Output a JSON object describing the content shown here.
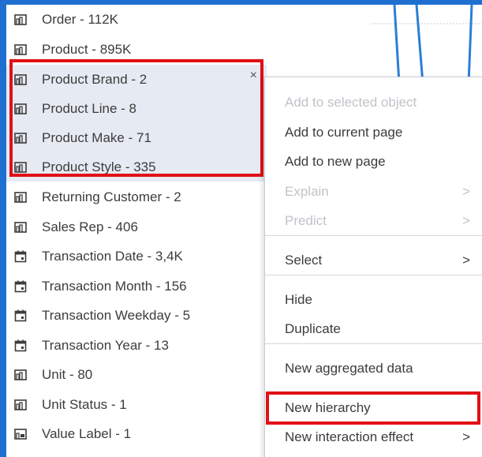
{
  "data_items": [
    {
      "label": "Order - 112K",
      "icon": "measure-icon"
    },
    {
      "label": "Product - 895K",
      "icon": "measure-icon"
    },
    {
      "label": "Product Brand - 2",
      "icon": "measure-icon"
    },
    {
      "label": "Product Line - 8",
      "icon": "measure-icon"
    },
    {
      "label": "Product Make - 71",
      "icon": "measure-icon"
    },
    {
      "label": "Product Style - 335",
      "icon": "measure-icon"
    },
    {
      "label": "Returning Customer - 2",
      "icon": "measure-icon"
    },
    {
      "label": "Sales Rep - 406",
      "icon": "measure-icon"
    },
    {
      "label": "Transaction Date - 3,4K",
      "icon": "calendar-icon"
    },
    {
      "label": "Transaction Month - 156",
      "icon": "calendar-icon"
    },
    {
      "label": "Transaction Weekday - 5",
      "icon": "calendar-icon"
    },
    {
      "label": "Transaction Year - 13",
      "icon": "calendar-icon"
    },
    {
      "label": "Unit - 80",
      "icon": "measure-icon"
    },
    {
      "label": "Unit Status - 1",
      "icon": "measure-icon"
    },
    {
      "label": "Value Label - 1",
      "icon": "label-icon"
    }
  ],
  "row_close_symbol": "×",
  "context_menu": {
    "items": [
      {
        "label": "Add to selected object",
        "disabled": true
      },
      {
        "label": "Add to current page",
        "disabled": false
      },
      {
        "label": "Add to new page",
        "disabled": false
      },
      {
        "label": "Explain",
        "disabled": true,
        "submenu": true
      },
      {
        "label": "Predict",
        "disabled": true,
        "submenu": true
      },
      {
        "label": "Select",
        "disabled": false,
        "submenu": true
      },
      {
        "label": "Hide",
        "disabled": false
      },
      {
        "label": "Duplicate",
        "disabled": false
      },
      {
        "label": "New aggregated data",
        "disabled": false
      },
      {
        "label": "New hierarchy",
        "disabled": false
      },
      {
        "label": "New interaction effect",
        "disabled": false,
        "submenu": true
      }
    ],
    "chevron": ">"
  },
  "colors": {
    "background": "#1f6fd1",
    "selection": "#e6eaf2",
    "highlight_outline": "#e01016",
    "chart_line": "#2a7fd4"
  }
}
